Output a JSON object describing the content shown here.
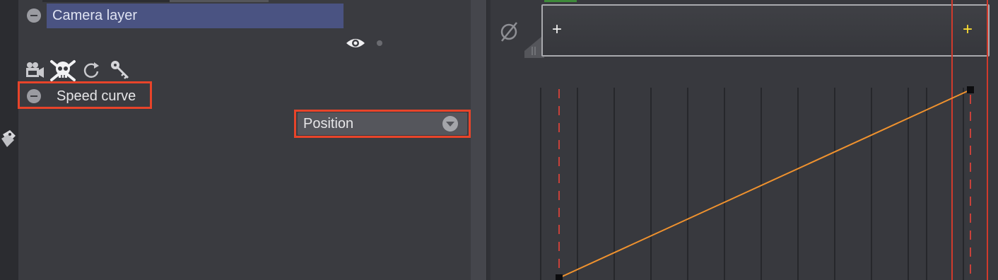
{
  "layers": {
    "camera_layer_label": "Camera layer",
    "speed_curve_label": "Speed curve"
  },
  "property_select": {
    "selected": "Position"
  },
  "toolbar": {
    "icons": [
      "camera-icon",
      "skull-icon",
      "reset-icon",
      "key-icon"
    ]
  },
  "timeline": {
    "add_left_label": "+",
    "add_right_label": "+",
    "null_symbol": "∅"
  },
  "colors": {
    "layer_highlight": "#4a5382",
    "callout_border": "#e8442a",
    "curve": "#f0922e",
    "playhead": "#d03a2c",
    "add_right": "#ffe033"
  }
}
